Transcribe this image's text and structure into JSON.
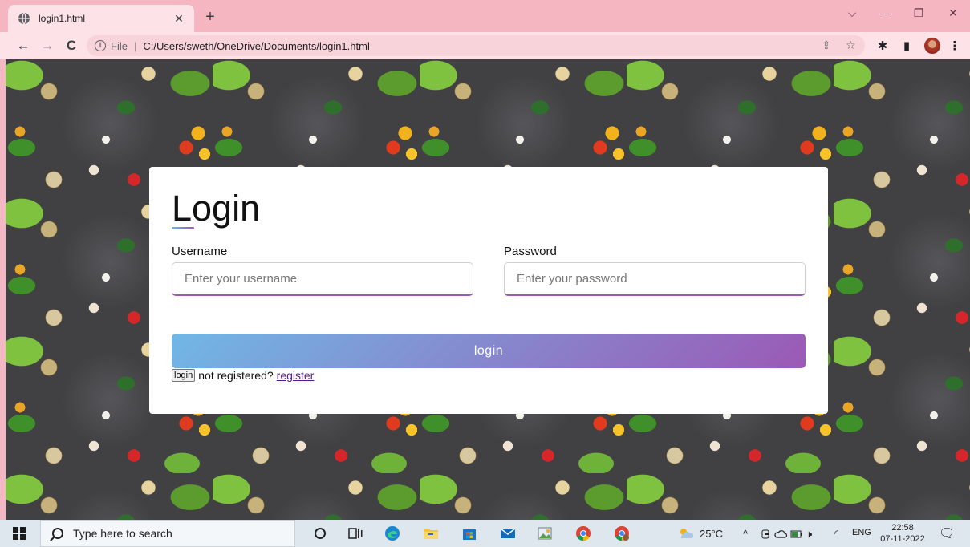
{
  "browser": {
    "tab_title": "login1.html",
    "tab_close": "✕",
    "new_tab": "+",
    "window_controls": {
      "dropdown": "⌵",
      "minimize": "—",
      "restore": "❐",
      "close": "✕"
    },
    "nav": {
      "back": "←",
      "forward": "→",
      "reload": "C"
    },
    "address": {
      "info": "i",
      "scheme": "File",
      "separator": "|",
      "path": "C:/Users/sweth/OneDrive/Documents/login1.html"
    },
    "toolbar_icons": {
      "share": "⇪",
      "bookmark": "☆",
      "extensions": "✱",
      "sidepanel": "▮",
      "menu": "⋮"
    }
  },
  "login_form": {
    "title": "Login",
    "username_label": "Username",
    "username_placeholder": "Enter your username",
    "username_value": "",
    "password_label": "Password",
    "password_placeholder": "Enter your password",
    "password_value": "",
    "submit_label": "login",
    "small_button_label": "login",
    "not_registered_text": "not registered?",
    "register_link": "register",
    "accent_colors": [
      "#71b7e6",
      "#9b59b6"
    ]
  },
  "taskbar": {
    "search_placeholder": "Type here to search",
    "apps": [
      "cortana-icon",
      "task-view-icon",
      "edge-icon",
      "file-explorer-icon",
      "store-icon",
      "mail-icon",
      "photos-icon",
      "chrome-icon",
      "chrome-profile-icon"
    ],
    "weather": "25°C",
    "tray_glyphs": {
      "chevron": "^",
      "speaker": "🕨",
      "wifi": "◜"
    },
    "language": "ENG",
    "time": "22:58",
    "date": "07-11-2022",
    "notification": "🗨"
  }
}
